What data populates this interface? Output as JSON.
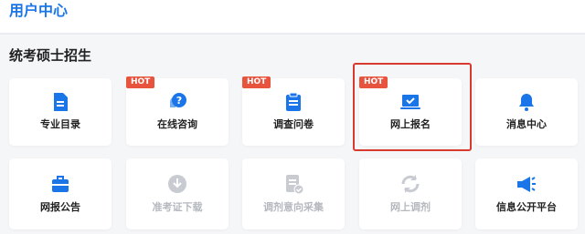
{
  "header": {
    "title": "用户中心"
  },
  "section": {
    "title": "统考硕士招生"
  },
  "badge": {
    "hot": "HOT"
  },
  "colors": {
    "accent": "#1a76e8",
    "hot": "#e8533e",
    "disabled": "#c8cbd1",
    "highlight": "#d93a30"
  },
  "tiles": [
    {
      "label": "专业目录",
      "icon": "document-icon",
      "hot": false,
      "enabled": true
    },
    {
      "label": "在线咨询",
      "icon": "chat-question-icon",
      "hot": true,
      "enabled": true
    },
    {
      "label": "调查问卷",
      "icon": "clipboard-icon",
      "hot": true,
      "enabled": true
    },
    {
      "label": "网上报名",
      "icon": "laptop-check-icon",
      "hot": true,
      "enabled": true,
      "highlighted": true
    },
    {
      "label": "消息中心",
      "icon": "bell-icon",
      "hot": false,
      "enabled": true
    },
    {
      "label": "网报公告",
      "icon": "briefcase-icon",
      "hot": false,
      "enabled": true
    },
    {
      "label": "准考证下载",
      "icon": "download-icon",
      "hot": false,
      "enabled": false
    },
    {
      "label": "调剂意向采集",
      "icon": "form-check-icon",
      "hot": false,
      "enabled": false
    },
    {
      "label": "网上调剂",
      "icon": "refresh-icon",
      "hot": false,
      "enabled": false
    },
    {
      "label": "信息公开平台",
      "icon": "megaphone-icon",
      "hot": false,
      "enabled": true
    }
  ]
}
